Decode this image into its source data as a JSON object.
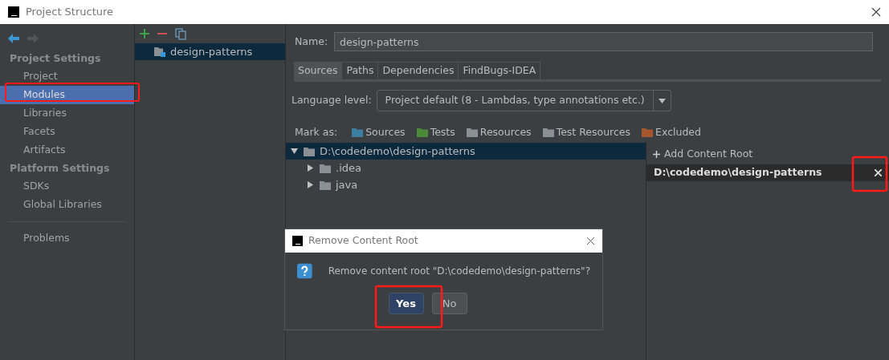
{
  "window": {
    "title": "Project Structure"
  },
  "sidebar": {
    "sections": [
      {
        "title": "Project Settings",
        "items": [
          {
            "label": "Project",
            "selected": false
          },
          {
            "label": "Modules",
            "selected": true
          },
          {
            "label": "Libraries",
            "selected": false
          },
          {
            "label": "Facets",
            "selected": false
          },
          {
            "label": "Artifacts",
            "selected": false
          }
        ]
      },
      {
        "title": "Platform Settings",
        "items": [
          {
            "label": "SDKs",
            "selected": false
          },
          {
            "label": "Global Libraries",
            "selected": false
          }
        ]
      }
    ],
    "footer_items": [
      {
        "label": "Problems",
        "selected": false
      }
    ]
  },
  "modules": [
    {
      "label": "design-patterns",
      "selected": true
    }
  ],
  "name_field": {
    "label": "Name:",
    "value": "design-patterns"
  },
  "tabs": [
    {
      "label": "Sources",
      "selected": true
    },
    {
      "label": "Paths",
      "selected": false
    },
    {
      "label": "Dependencies",
      "selected": false
    },
    {
      "label": "FindBugs-IDEA",
      "selected": false
    }
  ],
  "language_level": {
    "label": "Language level:",
    "value": "Project default (8 - Lambdas, type annotations etc.)"
  },
  "mark_as": {
    "label": "Mark as:",
    "items": [
      {
        "label": "Sources",
        "color": "#3d7fa3"
      },
      {
        "label": "Tests",
        "color": "#4b8a3a"
      },
      {
        "label": "Resources",
        "color": "#8a9095"
      },
      {
        "label": "Test Resources",
        "color": "#8a9095"
      },
      {
        "label": "Excluded",
        "color": "#a5562f"
      }
    ]
  },
  "tree": [
    {
      "label": "D:\\codedemo\\design-patterns",
      "expanded": true,
      "selected": true,
      "children": [
        {
          "label": ".idea",
          "expanded": false,
          "selected": false
        },
        {
          "label": "java",
          "expanded": false,
          "selected": false
        }
      ]
    }
  ],
  "content_roots": {
    "add_label": "Add Content Root",
    "items": [
      {
        "path": "D:\\codedemo\\design-patterns"
      }
    ]
  },
  "dialog": {
    "title": "Remove Content Root",
    "message": "Remove content root \"D:\\codedemo\\design-patterns\"?",
    "buttons": [
      {
        "label": "Yes",
        "selected": true
      },
      {
        "label": "No",
        "selected": false
      }
    ]
  }
}
